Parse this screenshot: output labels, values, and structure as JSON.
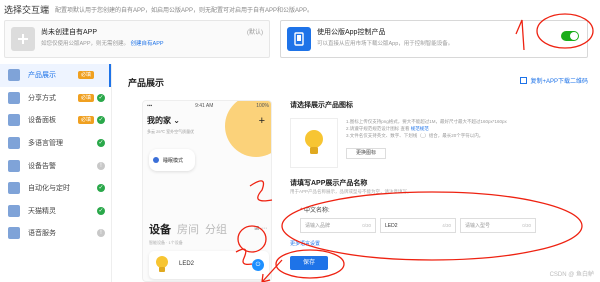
{
  "topbar": {
    "title": "选择交互端",
    "desc": "配置项默认用于您创建的自有APP，如启用公版APP，则无配置可对启用于自有APP和公版APP。"
  },
  "choices": {
    "left": {
      "title": "尚未创建自有APP",
      "desc": "如您仅使用公版APP，则无需创建。",
      "link": "创建自有APP",
      "tag": "(默认)"
    },
    "right": {
      "title": "使用公版App控制产品",
      "desc": "可以直接从应用市场下载公版App，用于控制智能设备。",
      "toggle": true
    }
  },
  "sidebar": {
    "items": [
      {
        "label": "产品展示",
        "badge": "必填",
        "status": "",
        "active": true
      },
      {
        "label": "分享方式",
        "badge": "必填",
        "status": "✓",
        "active": false
      },
      {
        "label": "设备面板",
        "badge": "必填",
        "status": "✓",
        "active": false
      },
      {
        "label": "多语言管理",
        "badge": "",
        "status": "✓",
        "active": false
      },
      {
        "label": "设备告警",
        "badge": "",
        "status": "!",
        "active": false
      },
      {
        "label": "自动化与定时",
        "badge": "",
        "status": "✓",
        "active": false
      },
      {
        "label": "天猫精灵",
        "badge": "",
        "status": "✓",
        "active": false
      },
      {
        "label": "语音服务",
        "badge": "",
        "status": "!",
        "active": false
      }
    ]
  },
  "main": {
    "heading": "产品展示",
    "qr_link": "复制+APP下载二维码"
  },
  "phone": {
    "time": "9:41 AM",
    "battery": "100%",
    "home_title": "我的家 ⌄",
    "weather": "多云 25℃   室外空气质量优",
    "scene": "睡眠模式",
    "tabs": [
      "设备",
      "房间",
      "分组"
    ],
    "tab_icons": "⊞ ⋯",
    "subtitle": "智能设备 · 1个设备",
    "device_name": "LED2"
  },
  "form": {
    "icon_title": "请选择展示产品图标",
    "hints": [
      "1.图标上传仅支持png格式，要大不能超过1M，最好尺寸最大不超过160px*160px",
      "2.请遵守规范规范设计图标 查看 ",
      "3.文件名仅支持英文、数字、下划线（_）组合，最长20个字符以内。"
    ],
    "hint_link": "规范规范",
    "change_btn": "更换图标",
    "name_title": "请填写APP展示产品名称",
    "name_desc": "用于APP产品名称展示，品牌或型号不能为空，请注意填写。",
    "lang_label": "中文名称:",
    "inputs": [
      {
        "placeholder": "请输入品牌",
        "count": "0/30",
        "filled": false
      },
      {
        "placeholder": "LED2",
        "count": "4/30",
        "filled": true
      },
      {
        "placeholder": "请输入型号",
        "count": "0/30",
        "filled": false
      }
    ],
    "more_link": "更多语言设置",
    "save": "保存"
  },
  "watermark": "CSDN @ 鱼白鲈"
}
